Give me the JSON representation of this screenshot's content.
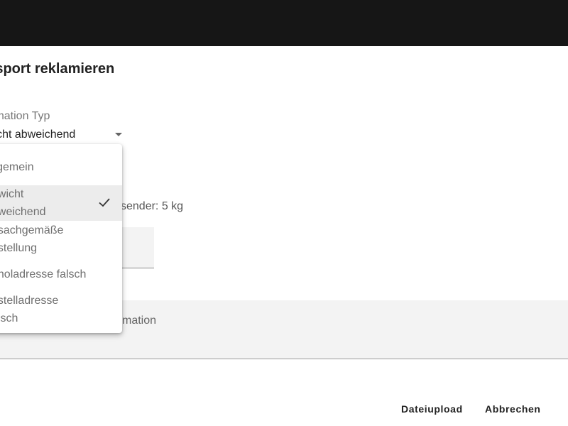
{
  "dialog": {
    "title": "ansport reklamieren"
  },
  "type_field": {
    "label": "klamation Typ",
    "value": "wicht abweichend",
    "icon": "dropdown-caret-icon"
  },
  "sender_info": "sender: 5 kg",
  "info_panel_text": "mation",
  "dropdown": {
    "items": [
      {
        "line1": "llgemein",
        "line2": ""
      },
      {
        "line1": "ewicht",
        "line2": "bweichend",
        "selected": true,
        "icon": "check-icon"
      },
      {
        "line1": "nsachgemäße",
        "line2": "ustellung"
      },
      {
        "line1": "bholadresse falsch",
        "line2": ""
      },
      {
        "line1": "ustelladresse",
        "line2": "alsch"
      }
    ]
  },
  "actions": {
    "upload_label": "Dateiupload",
    "cancel_label": "Abbrechen"
  },
  "colors": {
    "topbar": "#161616",
    "panel": "#f3f3f3",
    "text": "#222222"
  }
}
